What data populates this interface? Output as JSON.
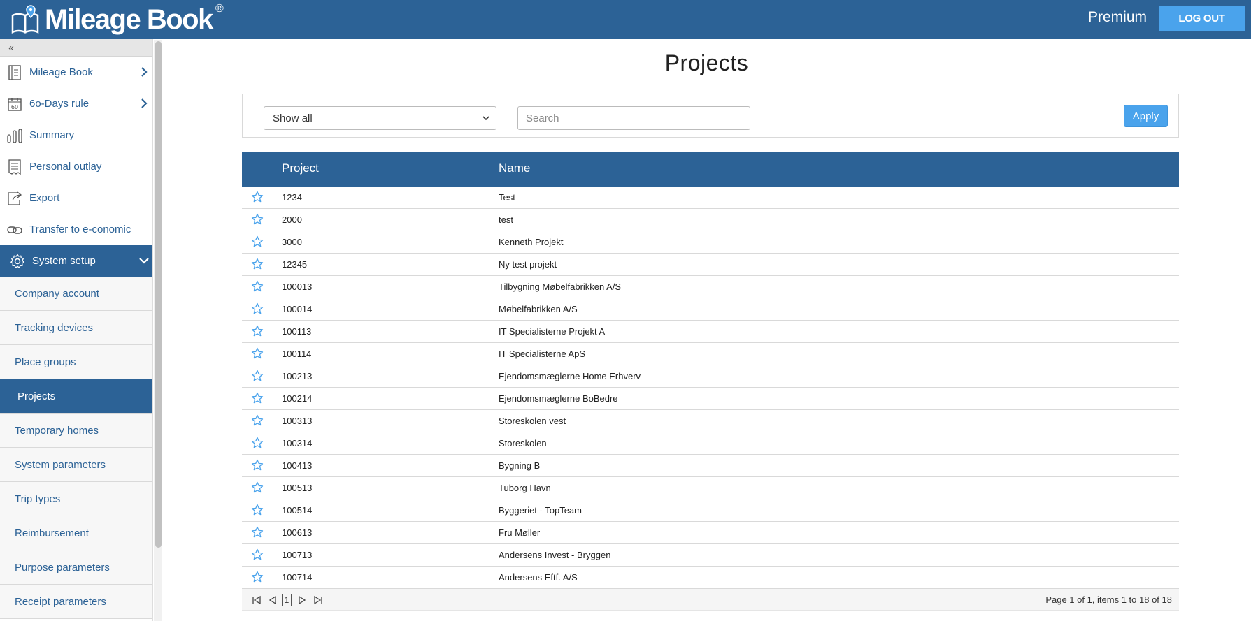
{
  "header": {
    "logo_text": "Mileage Book",
    "logo_reg": "®",
    "plan": "Premium",
    "logout_label": "LOG OUT"
  },
  "sidebar": {
    "collapse_label": "‹‹",
    "items": [
      {
        "label": "Mileage Book",
        "icon": "book-icon",
        "has_chevron": true
      },
      {
        "label": "6o-Days rule",
        "icon": "calendar-60-icon",
        "has_chevron": true
      },
      {
        "label": "Summary",
        "icon": "bar-chart-icon",
        "has_chevron": false
      },
      {
        "label": "Personal outlay",
        "icon": "receipt-icon",
        "has_chevron": false
      },
      {
        "label": "Export",
        "icon": "export-icon",
        "has_chevron": false
      },
      {
        "label": "Transfer to e-conomic",
        "icon": "link-icon",
        "has_chevron": false
      },
      {
        "label": "System setup",
        "icon": "gear-icon",
        "active": true,
        "expanded": true
      }
    ],
    "subitems": [
      {
        "label": "Company account"
      },
      {
        "label": "Tracking devices"
      },
      {
        "label": "Place groups"
      },
      {
        "label": "Projects",
        "active": true
      },
      {
        "label": "Temporary homes"
      },
      {
        "label": "System parameters"
      },
      {
        "label": "Trip types"
      },
      {
        "label": "Reimbursement"
      },
      {
        "label": "Purpose parameters"
      },
      {
        "label": "Receipt parameters"
      }
    ]
  },
  "main": {
    "title": "Projects",
    "filter": {
      "selected": "Show all",
      "search_placeholder": "Search",
      "apply_label": "Apply"
    },
    "table": {
      "columns": [
        "Project",
        "Name"
      ],
      "rows": [
        {
          "project": "1234",
          "name": "Test"
        },
        {
          "project": "2000",
          "name": "test"
        },
        {
          "project": "3000",
          "name": "Kenneth Projekt"
        },
        {
          "project": "12345",
          "name": "Ny test projekt"
        },
        {
          "project": "100013",
          "name": "Tilbygning Møbelfabrikken A/S"
        },
        {
          "project": "100014",
          "name": "Møbelfabrikken A/S"
        },
        {
          "project": "100113",
          "name": "IT Specialisterne Projekt A"
        },
        {
          "project": "100114",
          "name": "IT Specialisterne ApS"
        },
        {
          "project": "100213",
          "name": "Ejendomsmæglerne Home Erhverv"
        },
        {
          "project": "100214",
          "name": "Ejendomsmæglerne BoBedre"
        },
        {
          "project": "100313",
          "name": "Storeskolen vest"
        },
        {
          "project": "100314",
          "name": "Storeskolen"
        },
        {
          "project": "100413",
          "name": "Bygning B"
        },
        {
          "project": "100513",
          "name": "Tuborg Havn"
        },
        {
          "project": "100514",
          "name": "Byggeriet - TopTeam"
        },
        {
          "project": "100613",
          "name": "Fru Møller"
        },
        {
          "project": "100713",
          "name": "Andersens Invest - Bryggen"
        },
        {
          "project": "100714",
          "name": "Andersens Eftf. A/S"
        }
      ]
    },
    "pager": {
      "current_page": "1",
      "info": "Page 1 of 1, items 1 to 18 of 18"
    }
  },
  "colors": {
    "primary": "#2c6296",
    "accent": "#4aa3ec",
    "star": "#4aa3ec"
  }
}
